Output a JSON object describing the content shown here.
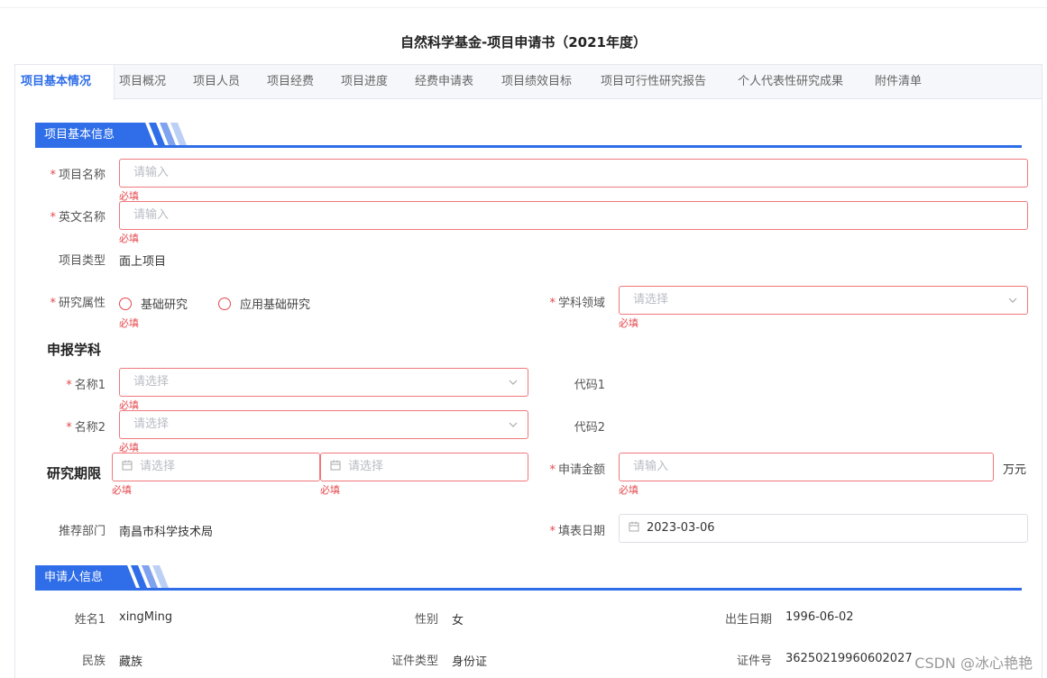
{
  "page_title": "自然科学基金-项目申请书（2021年度）",
  "tabs": [
    {
      "label": "项目基本情况",
      "active": true
    },
    {
      "label": "项目概况"
    },
    {
      "label": "项目人员"
    },
    {
      "label": "项目经费"
    },
    {
      "label": "项目进度"
    },
    {
      "label": "经费申请表"
    },
    {
      "label": "项目绩效目标"
    },
    {
      "label": "项目可行性研究报告"
    },
    {
      "label": "个人代表性研究成果"
    },
    {
      "label": "附件清单"
    }
  ],
  "section_basic": {
    "title": "项目基本信息"
  },
  "section_applicant": {
    "title": "申请人信息"
  },
  "required_msg": "必填",
  "placeholders": {
    "input": "请输入",
    "select": "请选择"
  },
  "fields": {
    "project_name": {
      "label": "项目名称"
    },
    "english_name": {
      "label": "英文名称"
    },
    "project_type": {
      "label": "项目类型",
      "value": "面上项目"
    },
    "research_attr": {
      "label": "研究属性",
      "options": [
        "基础研究",
        "应用基础研究"
      ]
    },
    "subject_area": {
      "label": "学科领域"
    },
    "declare_subject": {
      "title": "申报学科"
    },
    "name1": {
      "label": "名称1"
    },
    "code1": {
      "label": "代码1"
    },
    "name2": {
      "label": "名称2"
    },
    "code2": {
      "label": "代码2"
    },
    "research_period": {
      "title": "研究期限"
    },
    "apply_amount": {
      "label": "申请金额",
      "unit": "万元"
    },
    "recommend_dept": {
      "label": "推荐部门",
      "value": "南昌市科学技术局"
    },
    "fill_date": {
      "label": "填表日期",
      "value": "2023-03-06"
    }
  },
  "applicant": {
    "name": {
      "label": "姓名1",
      "value": "xingMing"
    },
    "gender": {
      "label": "性别",
      "value": "女"
    },
    "birth": {
      "label": "出生日期",
      "value": "1996-06-02"
    },
    "ethnicity": {
      "label": "民族",
      "value": "藏族"
    },
    "id_type": {
      "label": "证件类型",
      "value": "身份证"
    },
    "id_no": {
      "label": "证件号",
      "value": "362502199606020273"
    }
  },
  "watermark": "CSDN @冰心艳艳",
  "colors": {
    "accent": "#2f6ee8",
    "error": "#e5484d",
    "error_border": "#f0787c"
  }
}
